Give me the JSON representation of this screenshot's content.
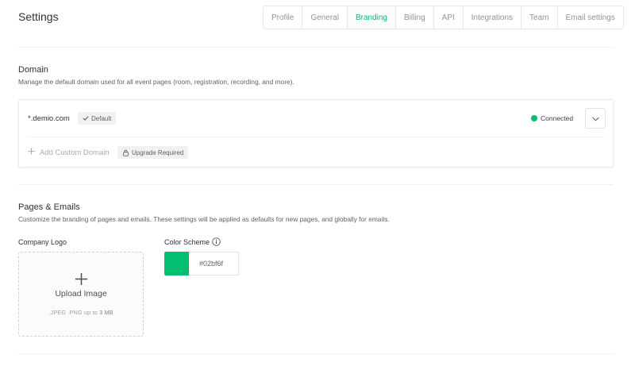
{
  "header": {
    "title": "Settings",
    "tabs": [
      {
        "label": "Profile"
      },
      {
        "label": "General"
      },
      {
        "label": "Branding",
        "active": true
      },
      {
        "label": "Billing"
      },
      {
        "label": "API"
      },
      {
        "label": "Integrations"
      },
      {
        "label": "Team"
      },
      {
        "label": "Email settings"
      }
    ]
  },
  "domain": {
    "title": "Domain",
    "description": "Manage the default domain used for all event pages (room, registration, recording, and more).",
    "name": "*.demio.com",
    "default_badge": "Default",
    "status": "Connected",
    "status_color": "#02bf6f",
    "add_custom_label": "Add Custom Domain",
    "upgrade_badge": "Upgrade Required"
  },
  "pages_emails": {
    "title": "Pages & Emails",
    "description": "Customize the branding of pages and emails. These settings will be applied as defaults for new pages, and globally for emails.",
    "company_logo": {
      "label": "Company Logo",
      "upload_label": "Upload Image",
      "hint_formats": ".JPEG .PNG",
      "hint_text": "up to",
      "hint_size": "3 MB"
    },
    "color_scheme": {
      "label": "Color Scheme",
      "value": "#02bf6f"
    }
  },
  "colors": {
    "accent": "#02bf6f"
  }
}
